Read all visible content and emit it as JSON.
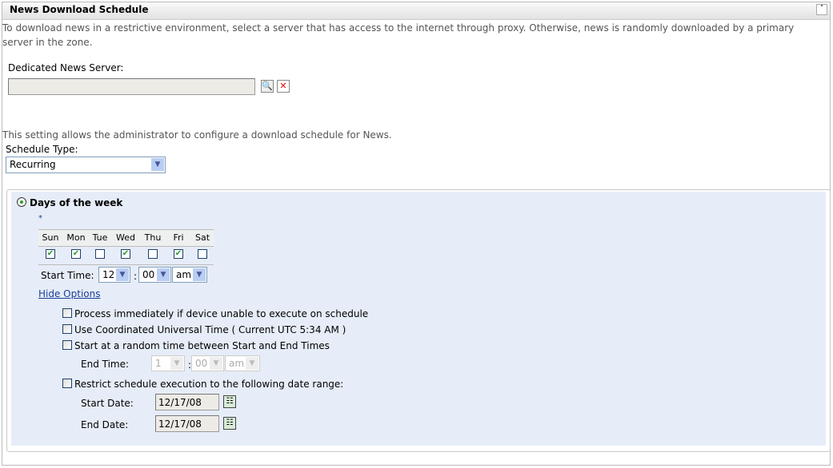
{
  "section": {
    "title": "News Download Schedule",
    "collapse_icon": "double-chevron-up-icon"
  },
  "intro": "To download news in a restrictive environment, select a server that has access to the internet through proxy. Otherwise, news is randomly downloaded by a primary server in the zone.",
  "server": {
    "label": "Dedicated News Server:",
    "value": "",
    "browse_icon": "search-icon",
    "clear_icon": "close-icon"
  },
  "schedule_note": "This setting allows the administrator to configure a download schedule for News.",
  "schedule_type": {
    "label": "Schedule Type:",
    "value": "Recurring"
  },
  "days": {
    "radio_label": "Days of the week",
    "required_mark": "*",
    "names": [
      "Sun",
      "Mon",
      "Tue",
      "Wed",
      "Thu",
      "Fri",
      "Sat"
    ],
    "checked": [
      true,
      true,
      false,
      true,
      false,
      true,
      false
    ]
  },
  "start_time": {
    "label": "Start Time:",
    "hour": "12",
    "sep": ":",
    "minute": "00",
    "ampm": "am"
  },
  "hide_options": "Hide Options",
  "options": {
    "process_immediately": "Process immediately if device unable to execute on schedule",
    "use_utc": "Use Coordinated Universal Time ( Current UTC 5:34 AM )",
    "random_start": "Start at a random time between Start and End Times",
    "end_time": {
      "label": "End Time:",
      "hour": "1",
      "sep": ":",
      "minute": "00",
      "ampm": "am"
    },
    "restrict_range": "Restrict schedule execution to the following date range:",
    "start_date": {
      "label": "Start Date:",
      "value": "12/17/08"
    },
    "end_date": {
      "label": "End Date:",
      "value": "12/17/08"
    }
  },
  "colors": {
    "panel": "#e6edf8",
    "link": "#1a3f9a",
    "check": "#2a9a2a"
  }
}
